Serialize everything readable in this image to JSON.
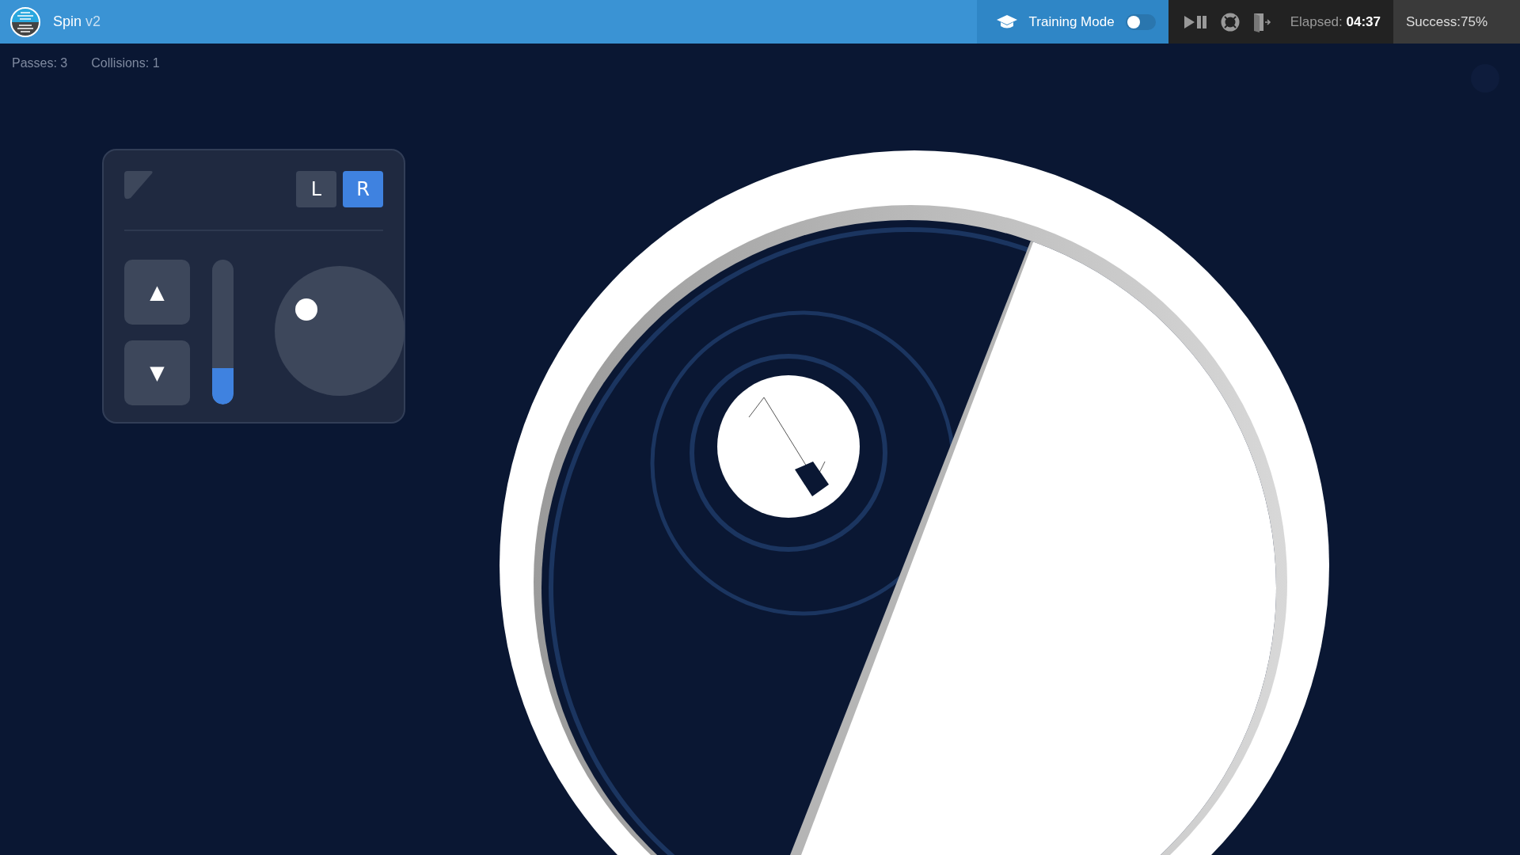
{
  "header": {
    "title": "Spin",
    "version": "v2",
    "training_mode": {
      "label": "Training Mode",
      "on": false
    },
    "elapsed": {
      "label": "Elapsed:",
      "value": "04:37"
    },
    "success": {
      "label": "Success:",
      "value": "75%"
    }
  },
  "stats": [
    {
      "label": "Passes: 3"
    },
    {
      "label": "Collisions: 1"
    }
  ],
  "control_panel": {
    "sides": [
      {
        "label": "L",
        "selected": false
      },
      {
        "label": "R",
        "selected": true
      }
    ],
    "nudge_buttons": [
      {
        "label": "▲"
      },
      {
        "label": "▼"
      }
    ],
    "throttle": {
      "level": 0.25
    }
  }
}
